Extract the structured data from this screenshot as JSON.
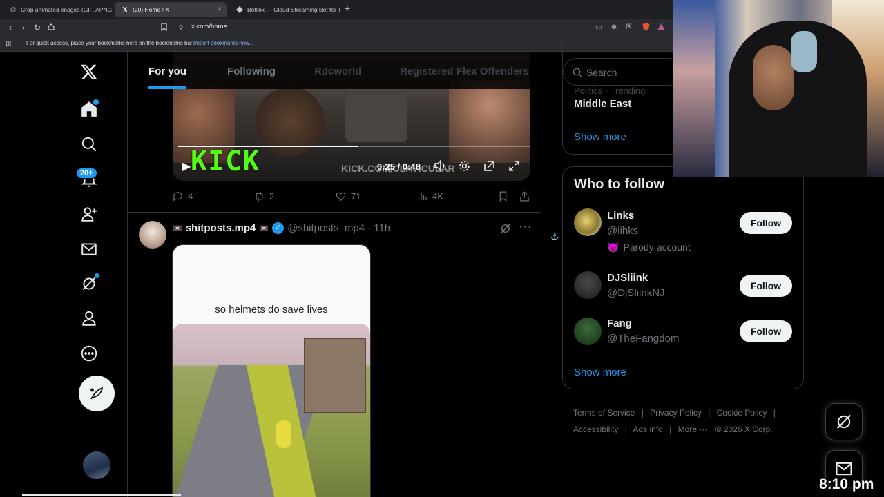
{
  "browser": {
    "tabs": [
      {
        "title": "Crop animated images (GIF, APNG, W"
      },
      {
        "title": "(20) Home / X",
        "close": "×"
      },
      {
        "title": "BotRix — Cloud Streaming Bot for Tw"
      }
    ],
    "new_tab": "+",
    "url": "x.com/home",
    "bookmarks_text": "For quick access, place your bookmarks here on the bookmarks bar.",
    "bookmarks_link": "Import bookmarks now..."
  },
  "nav": {
    "notification_badge": "20+"
  },
  "feed": {
    "tabs": [
      "For you",
      "Following",
      "Rdcworld",
      "Registered Flex Offenders"
    ],
    "video_post": {
      "overlay_logo": "KICK",
      "overlay_url": "KICK.COM/CLAVICULAR",
      "time": "0:25 / 0:48",
      "replies": "4",
      "reposts": "2",
      "likes": "71",
      "views": "4K"
    },
    "post": {
      "author": "shitposts.mp4",
      "handle": "@shitposts_mp4",
      "age": "· 11h",
      "caption": "so helmets do save lives"
    }
  },
  "sidebar": {
    "search_placeholder": "Search",
    "trend_meta": "Politics · Trending",
    "trend_title": "Middle East",
    "show_more": "Show more",
    "who_to_follow": "Who to follow",
    "accounts": [
      {
        "name": "Links",
        "handle": "@lihks",
        "note": "Parody account",
        "button": "Follow"
      },
      {
        "name": "DJSliink",
        "handle": "@DjSliinkNJ",
        "button": "Follow"
      },
      {
        "name": "Fang",
        "handle": "@TheFangdom",
        "button": "Follow"
      }
    ],
    "show_more_2": "Show more",
    "footer": {
      "terms": "Terms of Service",
      "privacy": "Privacy Policy",
      "cookie": "Cookie Policy",
      "accessibility": "Accessibility",
      "ads": "Ads info",
      "more": "More ···",
      "copyright": "© 2026 X Corp."
    }
  },
  "overlay": {
    "clock": "8:10 pm"
  },
  "colors": {
    "accent": "#1d9bf0",
    "background": "#000000",
    "border": "#2f3336"
  }
}
